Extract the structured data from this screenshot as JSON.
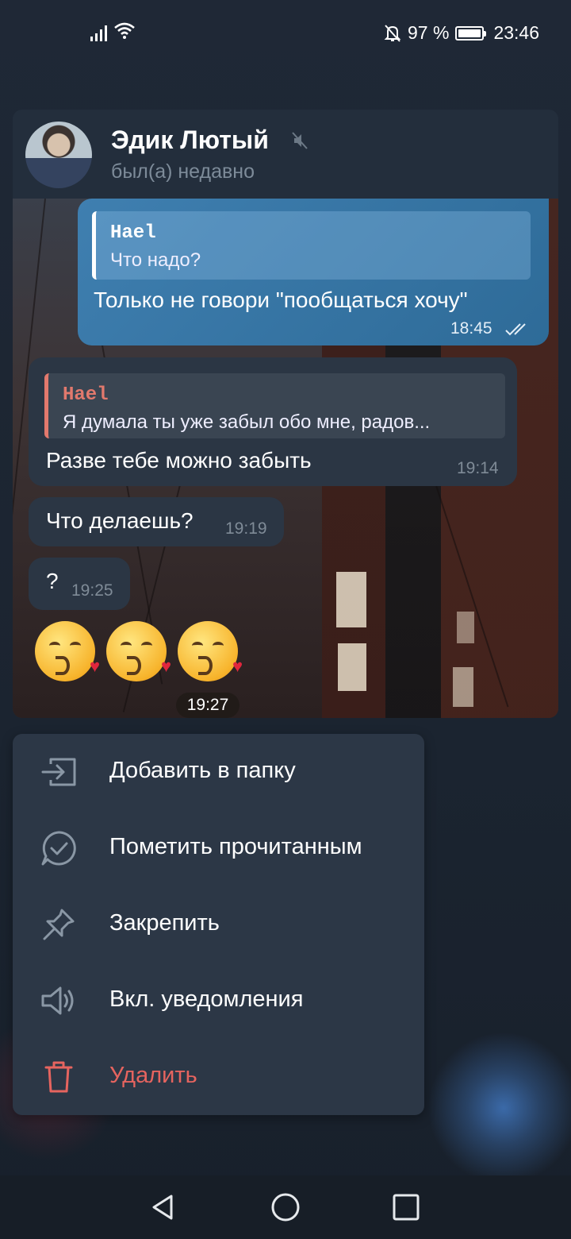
{
  "status_bar": {
    "battery_percent": "97 %",
    "time": "23:46"
  },
  "chat": {
    "name": "Эдик Лютый",
    "status": "был(а) недавно",
    "muted": true
  },
  "messages": {
    "outgoing": {
      "reply_name": "Hael",
      "reply_text": "Что надо?",
      "text": "Только не говори \"пообщаться хочу\"",
      "time": "18:45",
      "read": true
    },
    "incoming_1": {
      "reply_name": "Hael",
      "reply_text": "Я думала ты уже забыл обо мне, радов...",
      "text": "Разве тебе можно забыть",
      "time": "19:14"
    },
    "incoming_2": {
      "text": "Что делаешь?",
      "time": "19:19"
    },
    "incoming_3": {
      "text": "?",
      "time": "19:25"
    },
    "emoji_message": {
      "emoji": [
        "kissing-face-with-heart",
        "kissing-face-with-heart",
        "kissing-face-with-heart"
      ],
      "time": "19:27"
    }
  },
  "menu": {
    "items": [
      {
        "label": "Добавить в папку",
        "icon": "folder-add-icon"
      },
      {
        "label": "Пометить прочитанным",
        "icon": "mark-read-icon"
      },
      {
        "label": "Закрепить",
        "icon": "pin-icon"
      },
      {
        "label": "Вкл. уведомления",
        "icon": "speaker-icon"
      },
      {
        "label": "Удалить",
        "icon": "trash-icon",
        "danger": true
      }
    ]
  },
  "colors": {
    "accent_blue": "#3f7fb0",
    "danger": "#e6645f",
    "reply_incoming_bar": "#e2796d",
    "menu_bg": "#2c3746"
  }
}
